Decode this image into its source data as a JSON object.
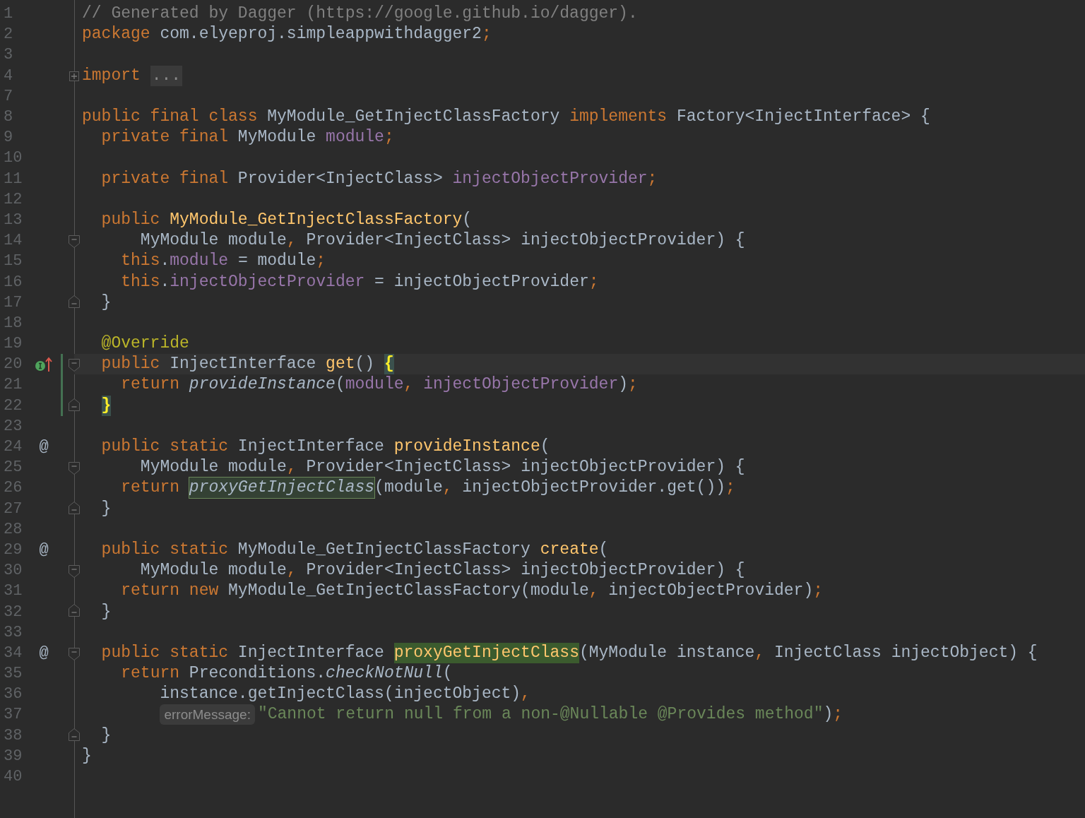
{
  "editor": {
    "lines": [
      {
        "number": "1",
        "tokens": [
          {
            "kind": "comment",
            "text": "// Generated by Dagger (https://google.github.io/dagger)."
          }
        ]
      },
      {
        "number": "2",
        "tokens": [
          {
            "kind": "kw",
            "text": "package "
          },
          {
            "kind": "plain",
            "text": "com.elyeproj.simpleappwithdagger2"
          },
          {
            "kind": "kw",
            "text": ";"
          }
        ]
      },
      {
        "number": "3"
      },
      {
        "number": "4",
        "fold": {
          "kind": "collapsed"
        },
        "tokens": [
          {
            "kind": "kw",
            "text": "import "
          },
          {
            "kind": "folded",
            "text": "..."
          }
        ]
      },
      {
        "number": "7"
      },
      {
        "number": "8",
        "tokens": [
          {
            "kind": "kw",
            "text": "public final class "
          },
          {
            "kind": "plain",
            "text": "MyModule_GetInjectClassFactory "
          },
          {
            "kind": "kw",
            "text": "implements "
          },
          {
            "kind": "plain",
            "text": "Factory<InjectInterface> {"
          }
        ]
      },
      {
        "number": "9",
        "tokens": [
          {
            "kind": "kw",
            "text": "  private final "
          },
          {
            "kind": "plain",
            "text": "MyModule "
          },
          {
            "kind": "field",
            "text": "module"
          },
          {
            "kind": "kw",
            "text": ";"
          }
        ]
      },
      {
        "number": "10"
      },
      {
        "number": "11",
        "tokens": [
          {
            "kind": "kw",
            "text": "  private final "
          },
          {
            "kind": "plain",
            "text": "Provider<InjectClass> "
          },
          {
            "kind": "field",
            "text": "injectObjectProvider"
          },
          {
            "kind": "kw",
            "text": ";"
          }
        ]
      },
      {
        "number": "12"
      },
      {
        "number": "13",
        "tokens": [
          {
            "kind": "kw",
            "text": "  public "
          },
          {
            "kind": "decl",
            "text": "MyModule_GetInjectClassFactory"
          },
          {
            "kind": "plain",
            "text": "("
          }
        ]
      },
      {
        "number": "14",
        "fold": {
          "kind": "start"
        },
        "tokens": [
          {
            "kind": "plain",
            "text": "      MyModule module"
          },
          {
            "kind": "kw",
            "text": ", "
          },
          {
            "kind": "plain",
            "text": "Provider<InjectClass> injectObjectProvider) {"
          }
        ]
      },
      {
        "number": "15",
        "tokens": [
          {
            "kind": "kw",
            "text": "    this"
          },
          {
            "kind": "plain",
            "text": "."
          },
          {
            "kind": "field",
            "text": "module"
          },
          {
            "kind": "plain",
            "text": " = module"
          },
          {
            "kind": "kw",
            "text": ";"
          }
        ]
      },
      {
        "number": "16",
        "tokens": [
          {
            "kind": "kw",
            "text": "    this"
          },
          {
            "kind": "plain",
            "text": "."
          },
          {
            "kind": "field",
            "text": "injectObjectProvider"
          },
          {
            "kind": "plain",
            "text": " = injectObjectProvider"
          },
          {
            "kind": "kw",
            "text": ";"
          }
        ]
      },
      {
        "number": "17",
        "fold": {
          "kind": "end"
        },
        "tokens": [
          {
            "kind": "plain",
            "text": "  }"
          }
        ]
      },
      {
        "number": "18"
      },
      {
        "number": "19",
        "tokens": [
          {
            "kind": "annotation",
            "text": "  @Override"
          }
        ]
      },
      {
        "number": "20",
        "current": true,
        "changed": true,
        "gutter": {
          "kind": "implements"
        },
        "fold": {
          "kind": "start"
        },
        "tokens": [
          {
            "kind": "kw",
            "text": "  public "
          },
          {
            "kind": "plain",
            "text": "InjectInterface "
          },
          {
            "kind": "decl",
            "text": "get"
          },
          {
            "kind": "plain",
            "text": "() "
          },
          {
            "kind": "brace",
            "text": "{"
          }
        ]
      },
      {
        "number": "21",
        "changed": true,
        "tokens": [
          {
            "kind": "kw",
            "text": "    return "
          },
          {
            "kind": "italic",
            "text": "provideInstance"
          },
          {
            "kind": "plain",
            "text": "("
          },
          {
            "kind": "field",
            "text": "module"
          },
          {
            "kind": "kw",
            "text": ", "
          },
          {
            "kind": "field",
            "text": "injectObjectProvider"
          },
          {
            "kind": "plain",
            "text": ")"
          },
          {
            "kind": "kw",
            "text": ";"
          }
        ]
      },
      {
        "number": "22",
        "changed": true,
        "fold": {
          "kind": "end"
        },
        "tokens": [
          {
            "kind": "brace",
            "text": "  }"
          }
        ]
      },
      {
        "number": "23"
      },
      {
        "number": "24",
        "gutter": {
          "kind": "text",
          "text": "@"
        },
        "tokens": [
          {
            "kind": "kw",
            "text": "  public static "
          },
          {
            "kind": "plain",
            "text": "InjectInterface "
          },
          {
            "kind": "decl",
            "text": "provideInstance"
          },
          {
            "kind": "plain",
            "text": "("
          }
        ]
      },
      {
        "number": "25",
        "fold": {
          "kind": "start"
        },
        "tokens": [
          {
            "kind": "plain",
            "text": "      MyModule module"
          },
          {
            "kind": "kw",
            "text": ", "
          },
          {
            "kind": "plain",
            "text": "Provider<InjectClass> injectObjectProvider) {"
          }
        ]
      },
      {
        "number": "26",
        "tokens": [
          {
            "kind": "kw",
            "text": "    return "
          },
          {
            "kind": "usage",
            "text": "proxyGetInjectClass"
          },
          {
            "kind": "plain",
            "text": "(module"
          },
          {
            "kind": "kw",
            "text": ", "
          },
          {
            "kind": "plain",
            "text": "injectObjectProvider.get())"
          },
          {
            "kind": "kw",
            "text": ";"
          }
        ]
      },
      {
        "number": "27",
        "fold": {
          "kind": "end"
        },
        "tokens": [
          {
            "kind": "plain",
            "text": "  }"
          }
        ]
      },
      {
        "number": "28"
      },
      {
        "number": "29",
        "gutter": {
          "kind": "text",
          "text": "@"
        },
        "tokens": [
          {
            "kind": "kw",
            "text": "  public static "
          },
          {
            "kind": "plain",
            "text": "MyModule_GetInjectClassFactory "
          },
          {
            "kind": "decl",
            "text": "create"
          },
          {
            "kind": "plain",
            "text": "("
          }
        ]
      },
      {
        "number": "30",
        "fold": {
          "kind": "start"
        },
        "tokens": [
          {
            "kind": "plain",
            "text": "      MyModule module"
          },
          {
            "kind": "kw",
            "text": ", "
          },
          {
            "kind": "plain",
            "text": "Provider<InjectClass> injectObjectProvider) {"
          }
        ]
      },
      {
        "number": "31",
        "tokens": [
          {
            "kind": "kw",
            "text": "    return new "
          },
          {
            "kind": "plain",
            "text": "MyModule_GetInjectClassFactory(module"
          },
          {
            "kind": "kw",
            "text": ", "
          },
          {
            "kind": "plain",
            "text": "injectObjectProvider)"
          },
          {
            "kind": "kw",
            "text": ";"
          }
        ]
      },
      {
        "number": "32",
        "fold": {
          "kind": "end"
        },
        "tokens": [
          {
            "kind": "plain",
            "text": "  }"
          }
        ]
      },
      {
        "number": "33"
      },
      {
        "number": "34",
        "gutter": {
          "kind": "text",
          "text": "@"
        },
        "fold": {
          "kind": "start"
        },
        "tokens": [
          {
            "kind": "kw",
            "text": "  public static "
          },
          {
            "kind": "plain",
            "text": "InjectInterface "
          },
          {
            "kind": "usage-decl",
            "text": "proxyGetInjectClass"
          },
          {
            "kind": "plain",
            "text": "(MyModule instance"
          },
          {
            "kind": "kw",
            "text": ", "
          },
          {
            "kind": "plain",
            "text": "InjectClass injectObject) {"
          }
        ]
      },
      {
        "number": "35",
        "tokens": [
          {
            "kind": "kw",
            "text": "    return "
          },
          {
            "kind": "plain",
            "text": "Preconditions."
          },
          {
            "kind": "italic",
            "text": "checkNotNull"
          },
          {
            "kind": "plain",
            "text": "("
          }
        ]
      },
      {
        "number": "36",
        "tokens": [
          {
            "kind": "plain",
            "text": "        instance.getInjectClass(injectObject)"
          },
          {
            "kind": "kw",
            "text": ","
          }
        ]
      },
      {
        "number": "37",
        "tokens": [
          {
            "kind": "hint",
            "text": "        errorMessage:"
          },
          {
            "kind": "string",
            "text": "\"Cannot return null from a non-@Nullable @Provides method\""
          },
          {
            "kind": "plain",
            "text": ")"
          },
          {
            "kind": "kw",
            "text": ";"
          }
        ]
      },
      {
        "number": "38",
        "fold": {
          "kind": "end"
        },
        "tokens": [
          {
            "kind": "plain",
            "text": "  }"
          }
        ]
      },
      {
        "number": "39",
        "tokens": [
          {
            "kind": "plain",
            "text": "}"
          }
        ]
      },
      {
        "number": "40"
      }
    ]
  }
}
